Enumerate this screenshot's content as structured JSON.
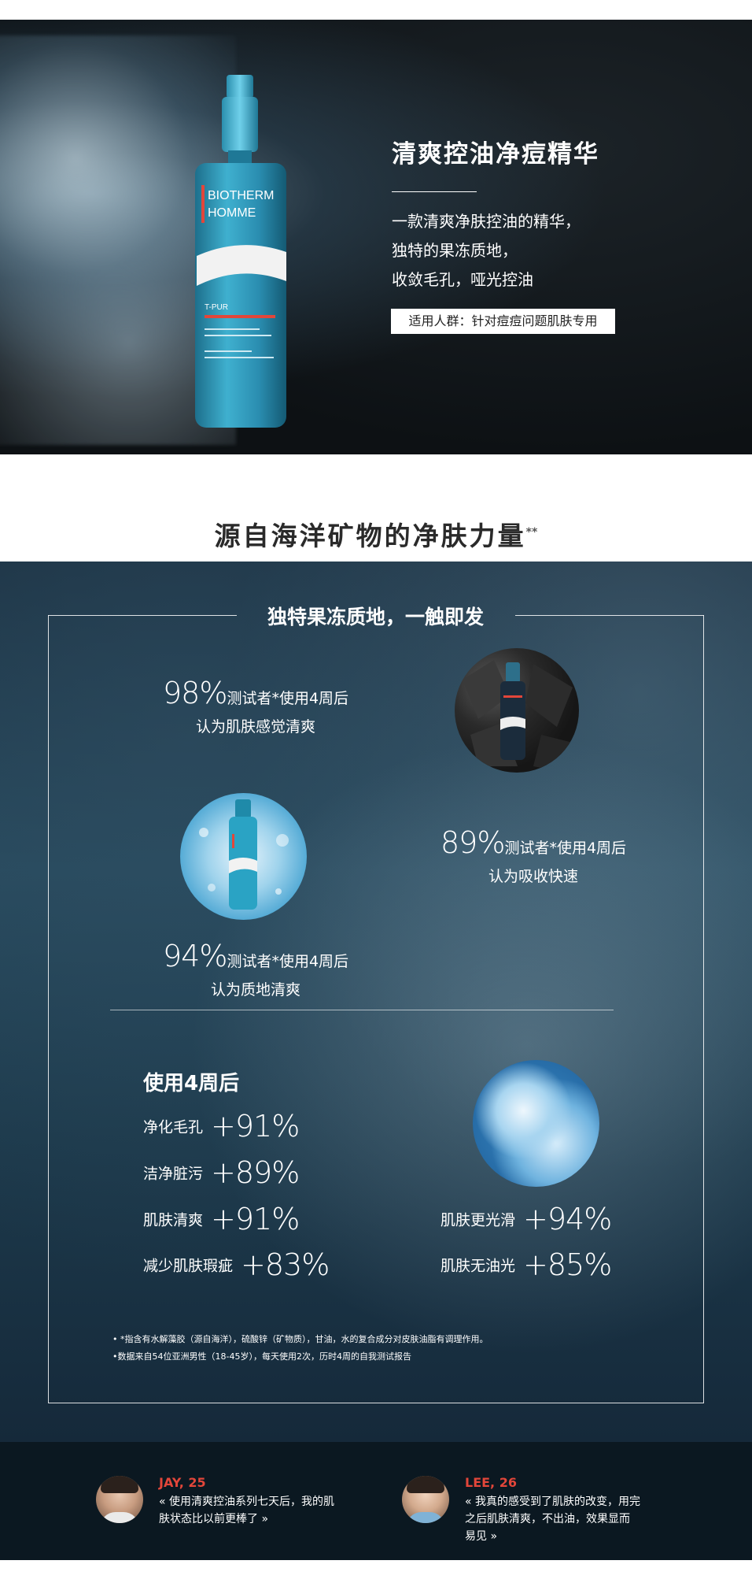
{
  "hero": {
    "brand_line1": "BIOTHERM",
    "brand_line2": "HOMME",
    "product_sub": "T-PUR",
    "title": "清爽控油净痘精华",
    "desc": [
      "一款清爽净肤控油的精华，",
      "独特的果冻质地，",
      "收敛毛孔，哑光控油"
    ],
    "badge": "适用人群：针对痘痘问题肌肤专用"
  },
  "section": {
    "title": "源自海洋矿物的净肤力量",
    "mark": "**"
  },
  "frame": {
    "heading": "独特果冻质地，一触即发",
    "stats": [
      {
        "pct": "98%",
        "line1": "测试者*使用4周后",
        "line2": "认为肌肤感觉清爽"
      },
      {
        "pct": "89%",
        "line1": "测试者*使用4周后",
        "line2": "认为吸收快速"
      },
      {
        "pct": "94%",
        "line1": "测试者*使用4周后",
        "line2": "认为质地清爽"
      }
    ],
    "after_title": "使用4周后",
    "benefits_left": [
      {
        "label": "净化毛孔",
        "value": "+91%"
      },
      {
        "label": "洁净脏污",
        "value": "+89%"
      },
      {
        "label": "肌肤清爽",
        "value": "+91%"
      },
      {
        "label": "减少肌肤瑕疵",
        "value": "+83%"
      }
    ],
    "benefits_right": [
      {
        "label": "肌肤更光滑",
        "value": "+94%"
      },
      {
        "label": "肌肤无油光",
        "value": "+85%"
      }
    ],
    "notes": [
      "• *指含有水解藻胶（源自海洋），硫酸锌（矿物质），甘油，水的复合成分对皮肤油脂有调理作用。",
      "•数据来自54位亚洲男性（18-45岁），每天使用2次，历时4周的自我测试报告"
    ]
  },
  "testimonials": [
    {
      "name": "JAY, 25",
      "text_line1": "« 使用清爽控油系列七天后，我的肌",
      "text_line2": "肤状态比以前更棒了 »",
      "text_line3": ""
    },
    {
      "name": "LEE, 26",
      "text_line1": "« 我真的感受到了肌肤的改变，用完",
      "text_line2": "之后肌肤清爽，不出油，效果显而",
      "text_line3": "易见 »"
    }
  ],
  "colors": {
    "accent_red": "#e2463a",
    "bottle_teal": "#2b8fae",
    "footer_bg": "#0b1821"
  },
  "icons": [
    "product-bottle-image",
    "coal-image",
    "bubble-image",
    "cloud-image",
    "avatar-jay",
    "avatar-lee"
  ]
}
